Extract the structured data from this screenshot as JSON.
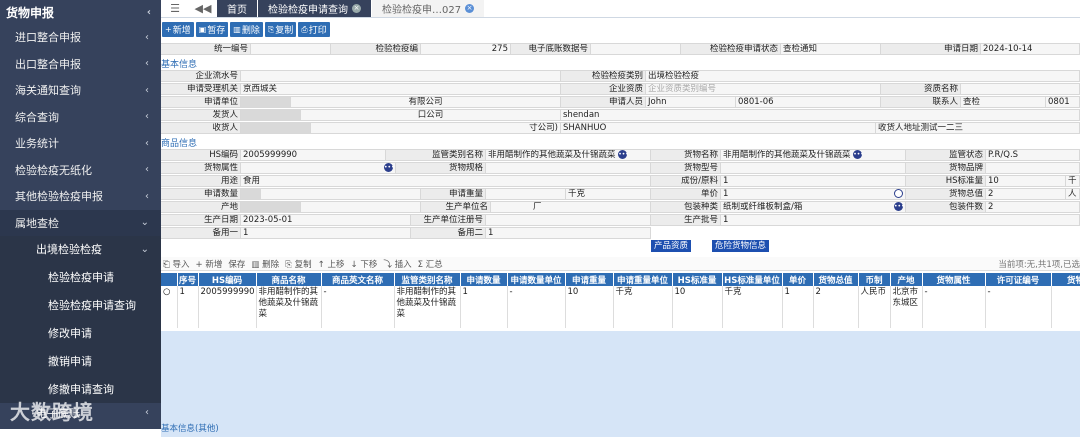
{
  "sidebar": {
    "top": "货物申报",
    "items": [
      "进口整合申报",
      "出口整合申报",
      "海关通知查询",
      "综合查询",
      "业务统计",
      "检验检疫无纸化",
      "其他检验检疫申报",
      "属地查检"
    ],
    "sub": "出境检验检疫",
    "leaves": [
      "检验检疫申请",
      "检验检疫申请查询",
      "修改申请",
      "撤销申请",
      "修撤申请查询"
    ],
    "bottom": "电子底账",
    "watermark": "大数跨境"
  },
  "tabs": {
    "home": "首页",
    "t1": "检验检疫申请查询",
    "t2": "检验检疫申…027"
  },
  "toolbar": {
    "new": "新增",
    "save": "暂存",
    "delete": "删除",
    "copy": "复制",
    "print": "打印"
  },
  "header": {
    "unified_no_label": "统一编号",
    "inspect_no_label": "检验检疫编",
    "inspect_no_tail": "275",
    "ledger_label": "电子底账数据号",
    "status_label": "检验检疫申请状态",
    "status_value": "查检通知",
    "apply_date_label": "申请日期",
    "apply_date_value": "2024-10-14"
  },
  "basic": {
    "title": "基本信息",
    "flow_label": "企业流水号",
    "category_label": "检验检疫类别",
    "category_value": "出境检验检疫",
    "authority_label": "申请受理机关",
    "authority_value": "京西城关",
    "ent_qual_label": "企业资质",
    "ent_qual_ph": "企业资质类别编号",
    "qual_name_label": "资质名称",
    "applicant_label": "申请单位",
    "applicant_tail": "有限公司",
    "applicant_person_label": "申请人员",
    "applicant_person": "John",
    "phone": "0801-06",
    "contact_label": "联系人",
    "contact_value": "查检",
    "contact_tail": "0801",
    "consignor_label": "发货人",
    "consignor_tail": "口公司",
    "consignor_en": "shendan",
    "consignee_label": "收货人",
    "consignee_tail": "寸公司)",
    "consignee_en": "SHANHUO",
    "consignee_addr_label": "收货人地址",
    "consignee_addr": "测试一二三"
  },
  "goods": {
    "title": "商品信息",
    "hs_label": "HS编码",
    "hs_value": "2005999990",
    "sup_cat_label": "监管类别名称",
    "sup_cat_value": "非用醋制作的其他蔬菜及什锦蔬菜",
    "goods_name_label": "货物名称",
    "goods_name_value": "非用醋制作的其他蔬菜及什锦蔬菜",
    "sup_cond_label": "监管状态",
    "sup_cond_value": "P.R/Q.S",
    "attr_label": "货物属性",
    "spec_label": "货物规格",
    "model_label": "货物型号",
    "brand_label": "货物品牌",
    "use_label": "用途",
    "use_value": "食用",
    "ingredient_label": "成份/原料",
    "ingredient_value": "1",
    "hs_std_label": "HS标准量",
    "hs_std_value": "10",
    "hs_std_tail": "千",
    "qty_label": "申请数量",
    "weight_label": "申请重量",
    "weight_unit": "千克",
    "price_label": "单价",
    "price_value": "1",
    "total_label": "货物总值",
    "total_value": "2",
    "total_tail": "人",
    "origin_label": "产地",
    "producer_label": "生产单位名",
    "producer_tail": "厂",
    "pack_label": "包装种类",
    "pack_value": "纸制或纤维板制盒/箱",
    "pack_count_label": "包装件数",
    "pack_count_value": "2",
    "prod_date_label": "生产日期",
    "prod_date_value": "2023-05-01",
    "reg_no_label": "生产单位注册号",
    "batch_label": "生产批号",
    "batch_value": "1",
    "spare1_label": "备用一",
    "spare1_value": "1",
    "spare2_label": "备用二",
    "spare2_value": "1",
    "btn_qual": "产品资质",
    "btn_danger": "危险货物信息"
  },
  "list": {
    "import": "导入",
    "new": "新增",
    "save": "保存",
    "delete": "删除",
    "copy": "复制",
    "up": "上移",
    "down": "下移",
    "insert": "插入",
    "sum": "汇总",
    "pager": "当前项:无,共1项,已选",
    "columns": [
      "序号",
      "HS编码",
      "商品名称",
      "商品英文名称",
      "监管类别名称",
      "申请数量",
      "申请数量单位",
      "申请重量",
      "申请重量单位",
      "HS标准量",
      "HS标准量单位",
      "单价",
      "货物总值",
      "币制",
      "产地",
      "货物属性",
      "许可证编号",
      "货物"
    ],
    "rows": [
      [
        "1",
        "2005999990",
        "非用醋制作的其他蔬菜及什锦蔬菜",
        "-",
        "非用醋制作的其他蔬菜及什锦蔬菜",
        "1",
        "-",
        "10",
        "千克",
        "10",
        "千克",
        "1",
        "2",
        "人民币",
        "北京市东城区",
        "-",
        "-",
        ""
      ]
    ]
  },
  "footer_title": "基本信息(其他)"
}
